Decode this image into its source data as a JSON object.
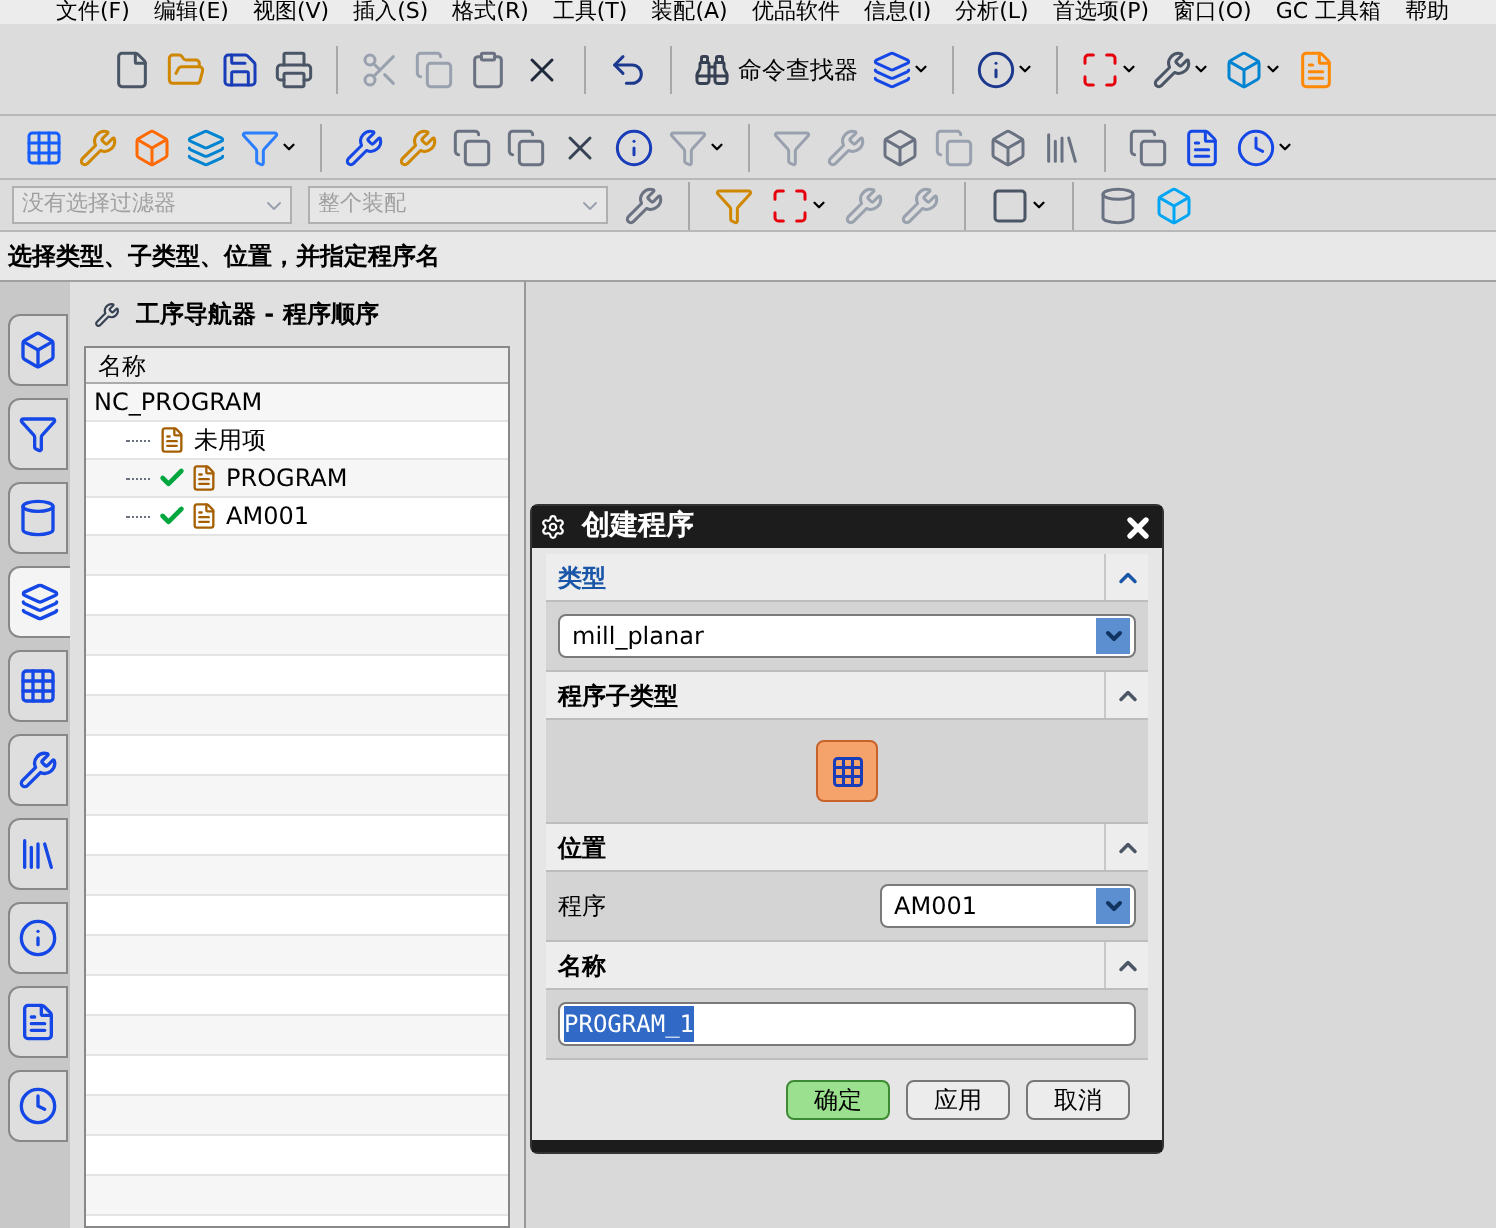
{
  "menu": [
    "文件(F)",
    "编辑(E)",
    "视图(V)",
    "插入(S)",
    "格式(R)",
    "工具(T)",
    "装配(A)",
    "优品软件",
    "信息(I)",
    "分析(L)",
    "首选项(P)",
    "窗口(O)",
    "GC 工具箱",
    "帮助"
  ],
  "toolbar": {
    "command_finder": "命令查找器"
  },
  "filter_bar": {
    "selection_filter": "没有选择过滤器",
    "scope": "整个装配"
  },
  "cue_line": "选择类型、子类型、位置，并指定程序名",
  "resource_tabs": [
    {
      "selected": false
    },
    {
      "selected": false
    },
    {
      "selected": false
    },
    {
      "selected": true
    },
    {
      "selected": false
    },
    {
      "selected": false
    },
    {
      "selected": false
    },
    {
      "selected": false
    },
    {
      "selected": false
    },
    {
      "selected": false
    }
  ],
  "navigator": {
    "title": "工序导航器 - 程序顺序",
    "column": "名称",
    "tree": [
      {
        "label": "NC_PROGRAM",
        "checked": false,
        "children": [
          {
            "label": "未用项",
            "checked": false
          },
          {
            "label": "PROGRAM",
            "checked": true
          },
          {
            "label": "AM001",
            "checked": true
          }
        ]
      }
    ]
  },
  "dialog": {
    "title": "创建程序",
    "sections": [
      {
        "kind": "select",
        "title": "类型",
        "active": true,
        "expanded": true,
        "value": "mill_planar"
      },
      {
        "kind": "icon_buttons",
        "title": "程序子类型",
        "active": false,
        "expanded": true,
        "buttons": [
          {
            "selected": true
          }
        ]
      },
      {
        "kind": "labeled_select",
        "title": "位置",
        "active": false,
        "expanded": true,
        "label": "程序",
        "value": "AM001"
      },
      {
        "kind": "text_input",
        "title": "名称",
        "active": false,
        "expanded": true,
        "value": "PROGRAM_1",
        "text_selected": true
      }
    ],
    "buttons": [
      {
        "label": "确定",
        "default": true
      },
      {
        "label": "应用",
        "default": false
      },
      {
        "label": "取消",
        "default": false
      }
    ]
  }
}
